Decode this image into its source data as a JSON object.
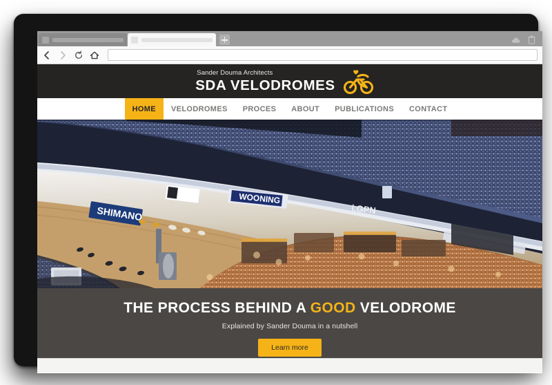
{
  "browser": {
    "tabs": [
      {
        "name": "tab-inactive",
        "title": "",
        "active": false
      },
      {
        "name": "tab-active",
        "title": "",
        "active": true
      }
    ],
    "new_tab_label": "+",
    "toolbar": {
      "back_icon": "back-arrow-icon",
      "forward_icon": "forward-arrow-icon",
      "reload_icon": "reload-icon",
      "home_icon": "home-icon",
      "address_value": "",
      "address_placeholder": ""
    },
    "tab_strip_icons": [
      {
        "name": "cloud-icon"
      },
      {
        "name": "trash-icon"
      }
    ]
  },
  "site": {
    "header": {
      "tagline": "Sander Douma Architects",
      "title": "SDA VELODROMES",
      "logo_icon": "cyclist-icon",
      "background": "#262422"
    },
    "nav": {
      "accent": "#f5b318",
      "items": [
        {
          "label": "HOME",
          "active": true
        },
        {
          "label": "VELODROMES",
          "active": false
        },
        {
          "label": "PROCES",
          "active": false
        },
        {
          "label": "ABOUT",
          "active": false
        },
        {
          "label": "PUBLICATIONS",
          "active": false
        },
        {
          "label": "CONTACT",
          "active": false
        }
      ]
    },
    "hero": {
      "image_alt": "Indoor velodrome with wooden track, cyclists racing and a crowded infield",
      "heading_part1": "THE PROCESS BEHIND A ",
      "heading_highlight": "GOOD",
      "heading_part2": " VELODROME",
      "subheading": "Explained by Sander Douma in a nutshell",
      "cta_label": "Learn more",
      "caption_background": "#4a4745",
      "cta_background": "#f5b318"
    }
  }
}
